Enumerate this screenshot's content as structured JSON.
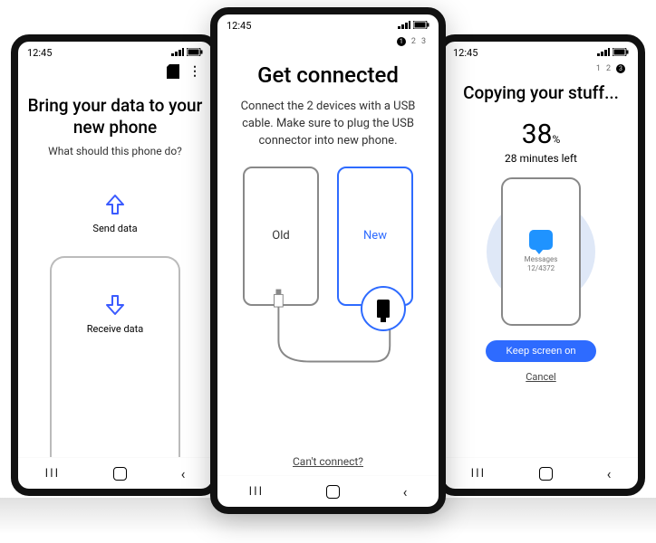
{
  "status": {
    "time": "12:45"
  },
  "left": {
    "title": "Bring your data to your new phone",
    "subtitle": "What should this phone do?",
    "send_label": "Send data",
    "receive_label": "Receive data"
  },
  "mid": {
    "steps": {
      "active": "1",
      "rest": [
        "2",
        "3"
      ]
    },
    "title": "Get connected",
    "subtitle": "Connect the 2 devices with a USB cable. Make sure to plug the USB connector into new phone.",
    "old_label": "Old",
    "new_label": "New",
    "cant_connect": "Can't connect?"
  },
  "right": {
    "steps": {
      "rest": [
        "1",
        "2"
      ],
      "active": "3"
    },
    "title": "Copying your stuff...",
    "percent": "38",
    "percent_unit": "%",
    "time_left": "28 minutes left",
    "item_label": "Messages",
    "item_count": "12/4372",
    "keep_screen": "Keep screen on",
    "cancel": "Cancel"
  }
}
